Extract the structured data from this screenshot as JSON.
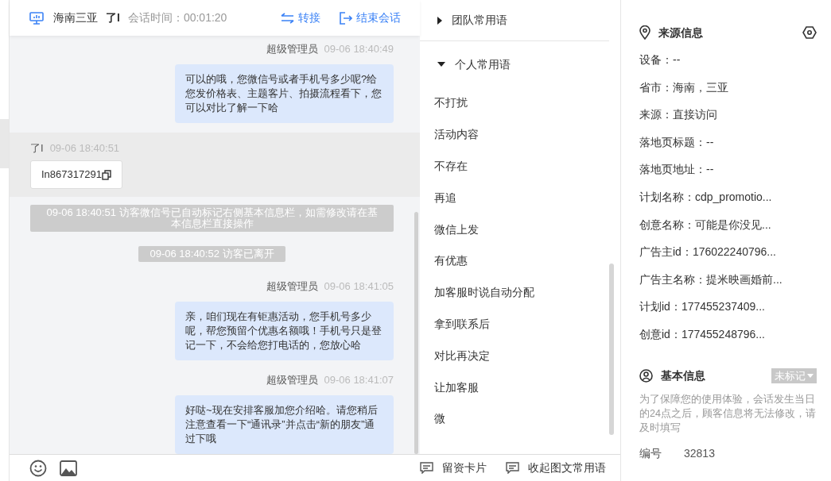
{
  "header": {
    "location": "海南三亚",
    "visitor": "了I",
    "session_time": "会话时间：00:01:20",
    "actions": [
      {
        "kind": "transfer",
        "label": "转接"
      },
      {
        "kind": "end",
        "label": "结束会话"
      }
    ]
  },
  "messages": [
    {
      "kind": "agent",
      "sender": "超级管理员",
      "time": "09-06 18:40:49",
      "text": "可以的哦，您微信号或者手机号多少呢?给您发价格表、主题客片、拍摄流程看下，您可以对比了解一下哈"
    },
    {
      "kind": "visitor",
      "sender": "了I",
      "time": "09-06 18:40:51",
      "text": "In867317291"
    },
    {
      "kind": "system",
      "text": "09-06 18:40:51 访客微信号已自动标记右侧基本信息栏，如需修改请在基本信息栏直接操作"
    },
    {
      "kind": "system",
      "text": "09-06 18:40:52 访客已离开"
    },
    {
      "kind": "agent",
      "sender": "超级管理员",
      "time": "09-06 18:41:05",
      "text": "亲，咱们现在有钜惠活动，您手机号多少呢，帮您预留个优惠名额哦！手机号只是登记一下，不会给您打电话的，您放心哈"
    },
    {
      "kind": "agent",
      "sender": "超级管理员",
      "time": "09-06 18:41:07",
      "text": "好哒~现在安排客服加您介绍哈。请您稍后注意查看一下“通讯录”并点击“新的朋友”通过下哦"
    }
  ],
  "toolbar": {
    "actions": [
      "留资卡片",
      "收起图文常用语"
    ]
  },
  "phrases": [
    {
      "title": "团队常用语",
      "expanded": false
    },
    {
      "title": "个人常用语",
      "expanded": true,
      "items": [
        "不打扰",
        "活动内容",
        "不存在",
        "再追",
        "微信上发",
        "有优惠",
        "加客服时说自动分配",
        "拿到联系后",
        "对比再决定",
        "让加客服",
        "微"
      ]
    }
  ],
  "source_info": {
    "title": "来源信息",
    "fields": [
      "设备：--",
      "省市：海南，三亚",
      "来源：直接访问",
      "落地页标题：--",
      "落地页地址：--",
      "计划名称：cdp_promotio...",
      "创意名称：可能是你没见...",
      "广告主id：176022240796...",
      "广告主名称：提米映画婚前...",
      "计划id：177455237409...",
      "创意id：177455248796..."
    ]
  },
  "basic_info": {
    "title": "基本信息",
    "tag": "未标记",
    "notice": "为了保障您的使用体验，会话发生当日的24点之后，顾客信息将无法修改，请及时填写",
    "fields": [
      {
        "label": "编号",
        "value": "32813"
      }
    ]
  }
}
